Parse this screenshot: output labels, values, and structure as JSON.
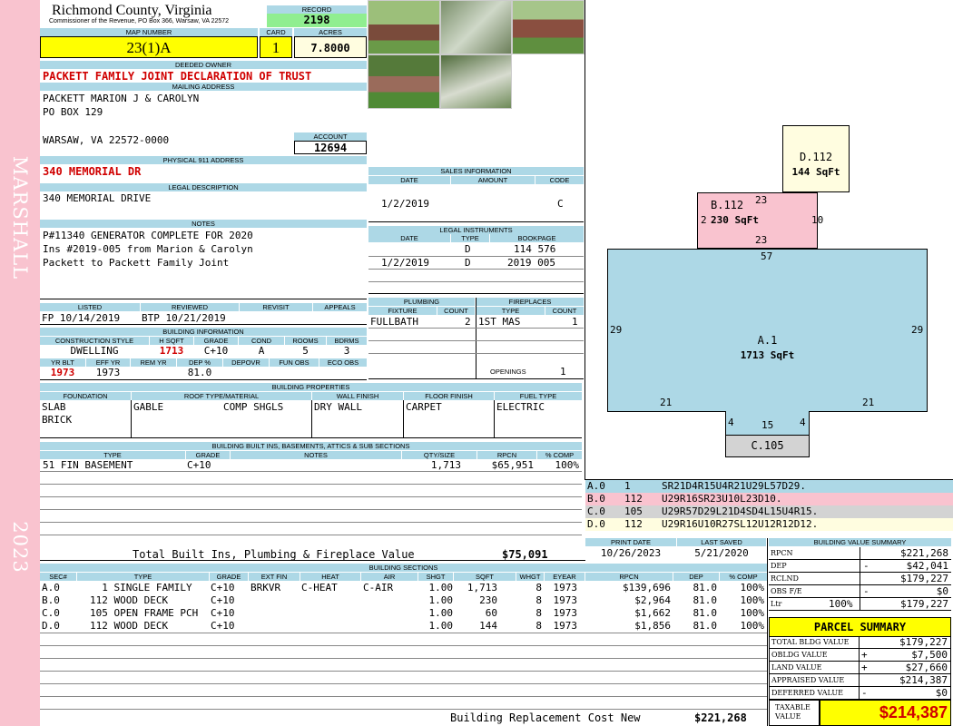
{
  "side": {
    "municipality": "MARSHALL",
    "year": "2023"
  },
  "header": {
    "county": "Richmond County, Virginia",
    "commissioner": "Commissioner of the Revenue, PO Box 366, Warsaw, VA 22572",
    "record_label": "RECORD",
    "record": "2198",
    "map_label": "MAP NUMBER",
    "map_number": "23(1)A",
    "card_label": "CARD",
    "card": "1",
    "acres_label": "ACRES",
    "acres": "7.8000"
  },
  "owner": {
    "label": "DEEDED OWNER",
    "name": "PACKETT FAMILY JOINT DECLARATION OF TRUST",
    "mailing_label": "MAILING ADDRESS",
    "mail1": "PACKETT MARION J & CAROLYN",
    "mail2": "PO BOX 129",
    "mail3": "WARSAW, VA 22572-0000",
    "account_label": "ACCOUNT",
    "account": "12694",
    "physical_label": "PHYSICAL 911 ADDRESS",
    "physical": "340 MEMORIAL DR",
    "legal_label": "LEGAL DESCRIPTION",
    "legal": "340 MEMORIAL DRIVE",
    "notes_label": "NOTES",
    "notes1": "P#11340 GENERATOR COMPLETE FOR 2020",
    "notes2": "Ins #2019-005 from Marion & Carolyn",
    "notes3": "Packett to Packett Family Joint"
  },
  "sales": {
    "label": "SALES INFORMATION",
    "cols": [
      "DATE",
      "AMOUNT",
      "CODE"
    ],
    "date": "1/2/2019",
    "code": "C"
  },
  "legal_inst": {
    "label": "LEGAL INSTRUMENTS",
    "cols": [
      "DATE",
      "TYPE",
      "BOOKPAGE"
    ],
    "rows": [
      {
        "date": "",
        "type": "D",
        "bookpage": "114 576"
      },
      {
        "date": "1/2/2019",
        "type": "D",
        "bookpage": "2019 005"
      }
    ]
  },
  "listing": {
    "cols": [
      "LISTED",
      "REVIEWED",
      "REVISIT",
      "APPEALS"
    ],
    "listed": "FP  10/14/2019",
    "reviewed": "BTP 10/21/2019"
  },
  "building_info": {
    "label": "BUILDING INFORMATION",
    "cols": [
      "CONSTRUCTION STYLE",
      "H SQFT",
      "GRADE",
      "COND",
      "ROOMS",
      "BDRMS"
    ],
    "style": "DWELLING",
    "hsqft": "1713",
    "grade": "C+10",
    "cond": "A",
    "rooms": "5",
    "bdrms": "3",
    "cols2": [
      "YR BLT",
      "EFF YR",
      "REM YR",
      "DEP %",
      "DEPOVR",
      "FUN OBS",
      "ECO OBS"
    ],
    "yrblt": "1973",
    "effyr": "1973",
    "dep": "81.0"
  },
  "plumbing": {
    "label": "PLUMBING",
    "cols": [
      "FIXTURE",
      "COUNT"
    ],
    "fixture": "FULLBATH",
    "count": "2"
  },
  "fireplaces": {
    "label": "FIREPLACES",
    "cols": [
      "TYPE",
      "COUNT"
    ],
    "type": "1ST MAS",
    "count": "1",
    "openings_label": "OPENINGS",
    "openings": "1"
  },
  "properties": {
    "label": "BUILDING PROPERTIES",
    "cols": [
      "FOUNDATION",
      "ROOF TYPE/MATERIAL",
      "WALL FINISH",
      "FLOOR FINISH",
      "FUEL TYPE"
    ],
    "foundation1": "SLAB",
    "foundation2": "BRICK",
    "roof_type": "GABLE",
    "roof_mat": "COMP SHGLS",
    "wall": "DRY WALL",
    "floor": "CARPET",
    "fuel": "ELECTRIC"
  },
  "builtins": {
    "label": "BUILDING BUILT INS, BASEMENTS, ATTICS & SUB SECTIONS",
    "cols": [
      "TYPE",
      "GRADE",
      "NOTES",
      "QTY/SIZE",
      "RPCN",
      "% COMP"
    ],
    "type": "51 FIN BASEMENT",
    "grade": "C+10",
    "qty": "1,713",
    "rpcn": "$65,951",
    "comp": "100%",
    "total_label": "Total Built Ins, Plumbing & Fireplace Value",
    "total": "$75,091"
  },
  "sketch": {
    "labels": [
      {
        "code": "D.112",
        "area": "144 SqFt"
      },
      {
        "code": "B.112",
        "area": "230 SqFt"
      },
      {
        "code": "A.1",
        "area": "1713 SqFt"
      },
      {
        "code": "C.105",
        "area": ""
      }
    ],
    "dims": [
      "23",
      "10",
      "23",
      "57",
      "29",
      "29",
      "21",
      "21",
      "4",
      "15",
      "4"
    ],
    "b_prefix": "2"
  },
  "sketch_legend": [
    {
      "a": "A.0",
      "b": "1",
      "c": "SR21D4R15U4R21U29L57D29.",
      "color": "#add8e6"
    },
    {
      "a": "B.0",
      "b": "112",
      "c": "U29R16SR23U10L23D10.",
      "color": "#f9c3cf"
    },
    {
      "a": "C.0",
      "b": "105",
      "c": "U29R57D29L21D4SD4L15U4R15.",
      "color": "#d3d3d3"
    },
    {
      "a": "D.0",
      "b": "112",
      "c": "U29R16U10R27SL12U12R12D12.",
      "color": "#fffde0"
    }
  ],
  "dates": {
    "print_label": "PRINT DATE",
    "print": "10/26/2023",
    "saved_label": "LAST SAVED",
    "saved": "5/21/2020"
  },
  "sections": {
    "label": "BUILDING SECTIONS",
    "cols": [
      "SEC#",
      "TYPE",
      "GRADE",
      "EXT FIN",
      "HEAT",
      "AIR",
      "SHGT",
      "SQFT",
      "WHGT",
      "EYEAR",
      "RPCN",
      "DEP",
      "% COMP"
    ],
    "rows": [
      {
        "sec": "A.0",
        "type": "1 SINGLE FAMILY",
        "grade": "C+10",
        "ext": "BRKVR",
        "heat": "C-HEAT",
        "air": "C-AIR",
        "shgt": "1.00",
        "sqft": "1,713",
        "whgt": "8",
        "eyear": "1973",
        "rpcn": "$139,696",
        "dep": "81.0",
        "comp": "100%"
      },
      {
        "sec": "B.0",
        "type": "112 WOOD DECK",
        "grade": "C+10",
        "ext": "",
        "heat": "",
        "air": "",
        "shgt": "1.00",
        "sqft": "230",
        "whgt": "8",
        "eyear": "1973",
        "rpcn": "$2,964",
        "dep": "81.0",
        "comp": "100%"
      },
      {
        "sec": "C.0",
        "type": "105 OPEN FRAME PCH",
        "grade": "C+10",
        "ext": "",
        "heat": "",
        "air": "",
        "shgt": "1.00",
        "sqft": "60",
        "whgt": "8",
        "eyear": "1973",
        "rpcn": "$1,662",
        "dep": "81.0",
        "comp": "100%"
      },
      {
        "sec": "D.0",
        "type": "112 WOOD DECK",
        "grade": "C+10",
        "ext": "",
        "heat": "",
        "air": "",
        "shgt": "1.00",
        "sqft": "144",
        "whgt": "8",
        "eyear": "1973",
        "rpcn": "$1,856",
        "dep": "81.0",
        "comp": "100%"
      }
    ],
    "total_label": "Building Replacement Cost New",
    "total": "$221,268"
  },
  "bvs": {
    "label": "BUILDING VALUE SUMMARY",
    "rows": [
      {
        "l": "RPCN",
        "s": "",
        "v": "$221,268"
      },
      {
        "l": "DEP",
        "s": "-",
        "v": "$42,041"
      },
      {
        "l": "RCLND",
        "s": "",
        "v": "$179,227"
      },
      {
        "l": "OBS F/E",
        "s": "-",
        "v": "$0"
      },
      {
        "l": "Ltr",
        "p": "100%",
        "s": "",
        "v": "$179,227"
      }
    ]
  },
  "parcel": {
    "label": "PARCEL SUMMARY",
    "rows": [
      {
        "l": "TOTAL BLDG VALUE",
        "s": "",
        "v": "$179,227"
      },
      {
        "l": "OBLDG VALUE",
        "s": "+",
        "v": "$7,500"
      },
      {
        "l": "LAND VALUE",
        "s": "+",
        "v": "$27,660"
      },
      {
        "l": "APPRAISED VALUE",
        "s": "",
        "v": "$214,387"
      },
      {
        "l": "DEFERRED VALUE",
        "s": "-",
        "v": "$0"
      }
    ],
    "taxable_label1": "TAXABLE",
    "taxable_label2": "VALUE",
    "taxable": "$214,387"
  },
  "photos": [
    "house-photo-1",
    "house-photo-2",
    "house-photo-3",
    "house-photo-4",
    "house-photo-5"
  ]
}
